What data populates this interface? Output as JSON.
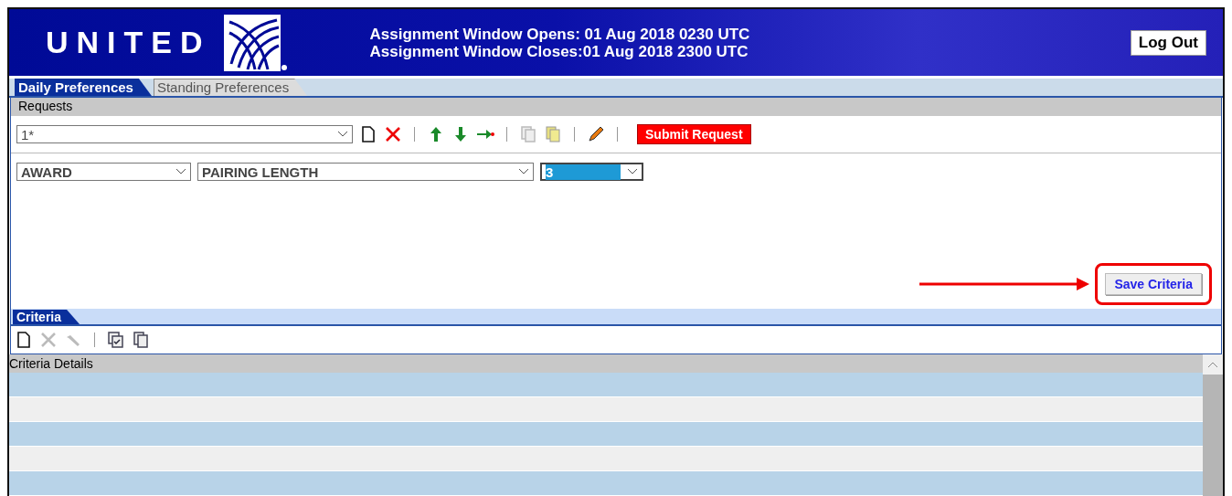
{
  "header": {
    "logo_text": "UNITED",
    "window_opens": "Assignment Window Opens: 01 Aug 2018 0230 UTC",
    "window_closes": "Assignment Window Closes:01 Aug 2018 2300 UTC",
    "logout": "Log Out"
  },
  "tabs": [
    {
      "label": "Daily Preferences",
      "selected": true
    },
    {
      "label": "Standing Preferences",
      "selected": false
    }
  ],
  "requests": {
    "title": "Requests",
    "request_select": "1*",
    "toolbar": [
      {
        "kind": "new",
        "disabled": false
      },
      {
        "kind": "delete",
        "disabled": false
      },
      {
        "kind": "sep"
      },
      {
        "kind": "up",
        "disabled": false
      },
      {
        "kind": "down",
        "disabled": false
      },
      {
        "kind": "move",
        "disabled": false
      },
      {
        "kind": "sep"
      },
      {
        "kind": "copy",
        "disabled": true
      },
      {
        "kind": "paste",
        "disabled": false
      },
      {
        "kind": "sep"
      },
      {
        "kind": "edit",
        "disabled": false
      },
      {
        "kind": "sep"
      }
    ],
    "submit": "Submit Request",
    "criteria_selects": [
      {
        "value": "AWARD",
        "selected": false
      },
      {
        "value": "PAIRING LENGTH",
        "selected": false
      },
      {
        "value": "3",
        "selected": true
      }
    ],
    "save": "Save Criteria",
    "callout": true
  },
  "criteria": {
    "tab": "Criteria",
    "toolbar": [
      {
        "kind": "new",
        "disabled": false
      },
      {
        "kind": "delete",
        "disabled": true
      },
      {
        "kind": "edit-tool",
        "disabled": true
      },
      {
        "kind": "sep"
      },
      {
        "kind": "copy-check",
        "disabled": false
      },
      {
        "kind": "copy",
        "disabled": false
      }
    ],
    "table_header": "Criteria Details"
  }
}
